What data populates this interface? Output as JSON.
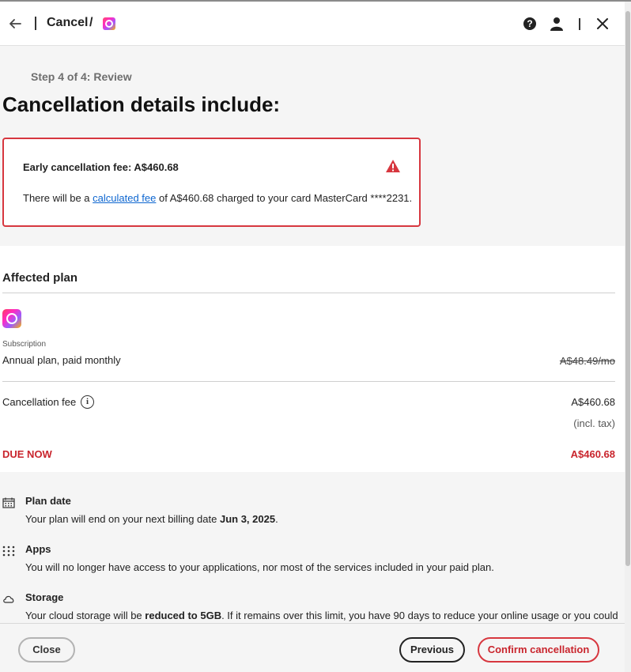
{
  "header": {
    "crumb": "Cancel",
    "separator": "/",
    "help_glyph": "?",
    "icons": [
      "back-arrow-icon",
      "creative-cloud-icon",
      "help-icon",
      "user-icon",
      "close-icon"
    ]
  },
  "step": "Step 4 of 4: Review",
  "title": "Cancellation details include:",
  "warning_box": {
    "title": "Early cancellation fee: A$460.68",
    "text_before": "There will be a ",
    "link": "calculated fee",
    "text_after": " of A$460.68 charged to your card MasterCard ****2231.",
    "border_color": "#d7373f"
  },
  "affected": {
    "title": "Affected plan",
    "subscription_label": "Subscription",
    "plan_name": "Annual plan, paid monthly",
    "old_price": "A$48.49/mo",
    "cancellation_fee_label": "Cancellation fee",
    "info_glyph": "i",
    "cancellation_fee_amount": "A$460.68",
    "tax_note": "(incl. tax)",
    "due_label": "DUE NOW",
    "due_amount": "A$460.68",
    "due_color": "#c9252d"
  },
  "details": [
    {
      "icon": "calendar-icon",
      "title": "Plan date",
      "text_before": "Your plan will end on your next billing date ",
      "text_bold": "Jun 3, 2025",
      "text_after": "."
    },
    {
      "icon": "apps-grid-icon",
      "title": "Apps",
      "text": "You will no longer have access to your applications, nor most of the services included in your paid plan."
    },
    {
      "icon": "cloud-icon",
      "title": "Storage",
      "text_before": "Your cloud storage will be ",
      "text_bold": "reduced to 5GB",
      "text_after": ". If it remains over this limit, you have 90 days to reduce your online usage or you could"
    }
  ],
  "footer": {
    "close_label": "Close",
    "previous_label": "Previous",
    "confirm_label": "Confirm cancellation"
  }
}
